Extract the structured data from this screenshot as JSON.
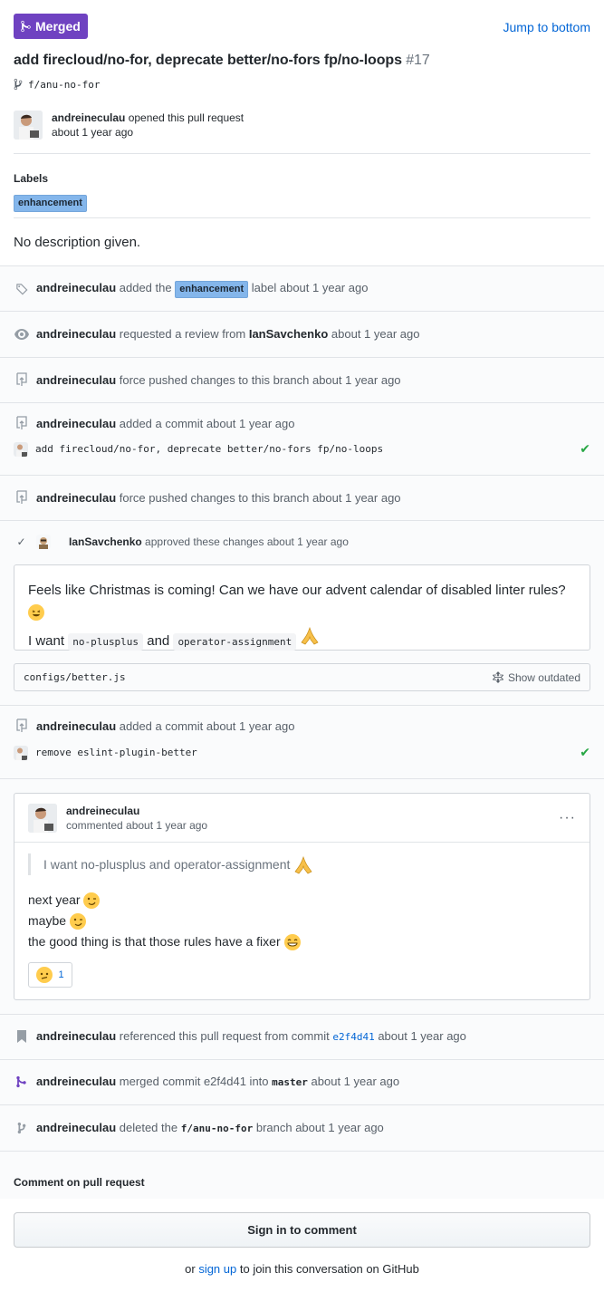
{
  "header": {
    "status_badge": "Merged",
    "jump_link": "Jump to bottom",
    "title": "add firecloud/no-for, deprecate better/no-fors fp/no-loops",
    "number": "#17",
    "branch": "f/anu-no-for"
  },
  "opened": {
    "author": "andreineculau",
    "action": "opened this pull request",
    "time": "about 1 year ago"
  },
  "labels": {
    "heading": "Labels",
    "items": [
      "enhancement"
    ]
  },
  "description": "No description given.",
  "timeline": {
    "label_event": {
      "actor": "andreineculau",
      "pre": "added the",
      "label": "enhancement",
      "post": "label about 1 year ago"
    },
    "review_request": {
      "actor": "andreineculau",
      "pre": "requested a review from",
      "reviewer": "IanSavchenko",
      "post": "about 1 year ago"
    },
    "force_push_1": {
      "actor": "andreineculau",
      "text": "force pushed changes to this branch about 1 year ago"
    },
    "commit_event_1": {
      "actor": "andreineculau",
      "text": "added a commit about 1 year ago",
      "message": "add firecloud/no-for, deprecate better/no-fors fp/no-loops"
    },
    "force_push_2": {
      "actor": "andreineculau",
      "text": "force pushed changes to this branch about 1 year ago"
    },
    "review": {
      "actor": "IanSavchenko",
      "text": "approved these changes about 1 year ago",
      "body_line1": "Feels like Christmas is coming! Can we have our advent calendar of disabled linter rules?",
      "body_line2_pre": "I want",
      "code1": "no-plusplus",
      "body_line2_mid": "and",
      "code2": "operator-assignment",
      "file": "configs/better.js",
      "show_outdated": "Show outdated"
    },
    "commit_event_2": {
      "actor": "andreineculau",
      "text": "added a commit about 1 year ago",
      "message": "remove eslint-plugin-better"
    },
    "comment": {
      "author": "andreineculau",
      "meta": "commented about 1 year ago",
      "menu": "···",
      "quote": "I want no-plusplus and operator-assignment",
      "lines": [
        "next year",
        "maybe",
        "the good thing is that those rules have a fixer"
      ],
      "reaction_count": "1"
    },
    "reference_event": {
      "actor": "andreineculau",
      "pre": "referenced this pull request from commit",
      "commit": "e2f4d41",
      "post": "about 1 year ago"
    },
    "merge_event": {
      "actor": "andreineculau",
      "pre": "merged commit e2f4d41 into",
      "branch": "master",
      "post": "about 1 year ago"
    },
    "delete_event": {
      "actor": "andreineculau",
      "pre": "deleted the",
      "branch": "f/anu-no-for",
      "post": "branch about 1 year ago"
    }
  },
  "footer": {
    "comment_heading": "Comment on pull request",
    "sign_in_button": "Sign in to comment",
    "signup_pre": "or",
    "signup_link": "sign up",
    "signup_post": "to join this conversation on GitHub"
  },
  "colors": {
    "merged_purple": "#6f42c1",
    "link_blue": "#0366d6",
    "label_blue": "#84b6eb",
    "success_green": "#28a745"
  },
  "icons": [
    "git-merge-icon",
    "git-branch-icon",
    "tag-icon",
    "eye-icon",
    "repo-push-icon",
    "git-commit-icon",
    "check-icon",
    "unfold-icon",
    "kebab-icon",
    "bookmark-icon",
    "trash-branch-icon"
  ]
}
